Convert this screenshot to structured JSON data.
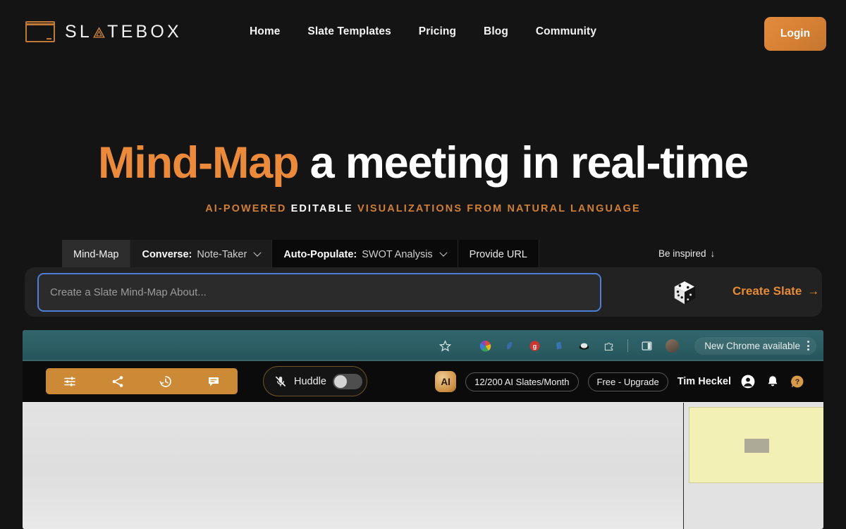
{
  "brand": {
    "logo_text_before": "SL",
    "logo_text_after": "TEBOX",
    "logo_icon": "slate-board-icon",
    "accent_color": "#ec8a3b",
    "logo_border_color": "#c1793a"
  },
  "nav": {
    "links": [
      {
        "label": "Home"
      },
      {
        "label": "Slate Templates"
      },
      {
        "label": "Pricing"
      },
      {
        "label": "Blog"
      },
      {
        "label": "Community"
      }
    ],
    "login_label": "Login"
  },
  "hero": {
    "title_accent": "Mind-Map",
    "title_rest": " a meeting in real-time",
    "sub_part1": "AI-POWERED ",
    "sub_part2": "EDITABLE",
    "sub_part3": " VISUALIZATIONS FROM NATURAL LANGUAGE"
  },
  "tabs": {
    "items": [
      {
        "label": "Mind-Map",
        "active": true
      },
      {
        "prefix": "Converse:",
        "value": "Note-Taker",
        "has_chevron": true
      },
      {
        "prefix": "Auto-Populate:",
        "value": "SWOT Analysis",
        "has_chevron": true
      },
      {
        "label": "Provide URL"
      }
    ],
    "be_inspired_label": "Be inspired",
    "be_inspired_arrow": "↓"
  },
  "prompt": {
    "placeholder": "Create a Slate Mind-Map About...",
    "value": "",
    "dice_icon": "dice-icon",
    "cta_label": "Create Slate",
    "cta_arrow": "→",
    "cta_color": "#e88b35",
    "focus_ring_color": "#4d7fd6"
  },
  "browser_mock": {
    "chrome": {
      "icons": [
        "star-icon",
        "colorwheel-extension-icon",
        "blue-extension-icon",
        "grammarly-extension-icon",
        "blue-doc-extension-icon",
        "black-oval-extension-icon",
        "puzzle-extensions-icon"
      ],
      "sidepanel_icon": "side-panel-icon",
      "profile_icon": "profile-avatar",
      "update_label": "New Chrome available",
      "kebab_icon": "kebab-menu-icon"
    },
    "app_toolbar": {
      "tools": [
        "sliders-settings-icon",
        "share-icon",
        "history-clock-icon",
        "comment-icon"
      ],
      "huddle": {
        "mic_icon": "mic-muted-icon",
        "label": "Huddle",
        "toggle_state": "off"
      },
      "ai_badge_label": "AI",
      "quota_label": "12/200 AI Slates/Month",
      "plan_label": "Free - Upgrade",
      "user_name": "Tim Heckel",
      "account_icon": "account-circle-icon",
      "bell_icon": "bell-icon",
      "help_icon": "help-question-icon",
      "toolbar_color": "#cc8a36"
    },
    "canvas": {
      "background_color": "#e2e2e2",
      "note_card_color": "#f2f0b4"
    }
  }
}
